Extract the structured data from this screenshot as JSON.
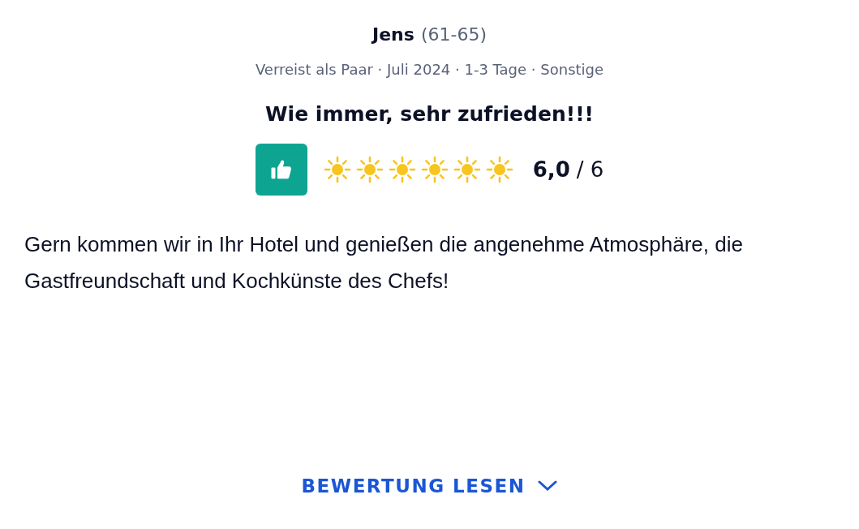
{
  "reviewer": {
    "name": "Jens",
    "age": "(61-65)"
  },
  "meta": "Verreist als Paar · Juli 2024 · 1-3 Tage · Sonstige",
  "title": "Wie immer, sehr zufrieden!!!",
  "rating": {
    "recommended": true,
    "stars": 6,
    "score": "6,0",
    "max": "/ 6"
  },
  "text": "Gern kommen wir in Ihr Hotel und genießen die angenehme Atmosphäre, die Gastfreundschaft und Kochkünste des Chefs!",
  "read_button": {
    "label": "BEWERTUNG LESEN"
  }
}
